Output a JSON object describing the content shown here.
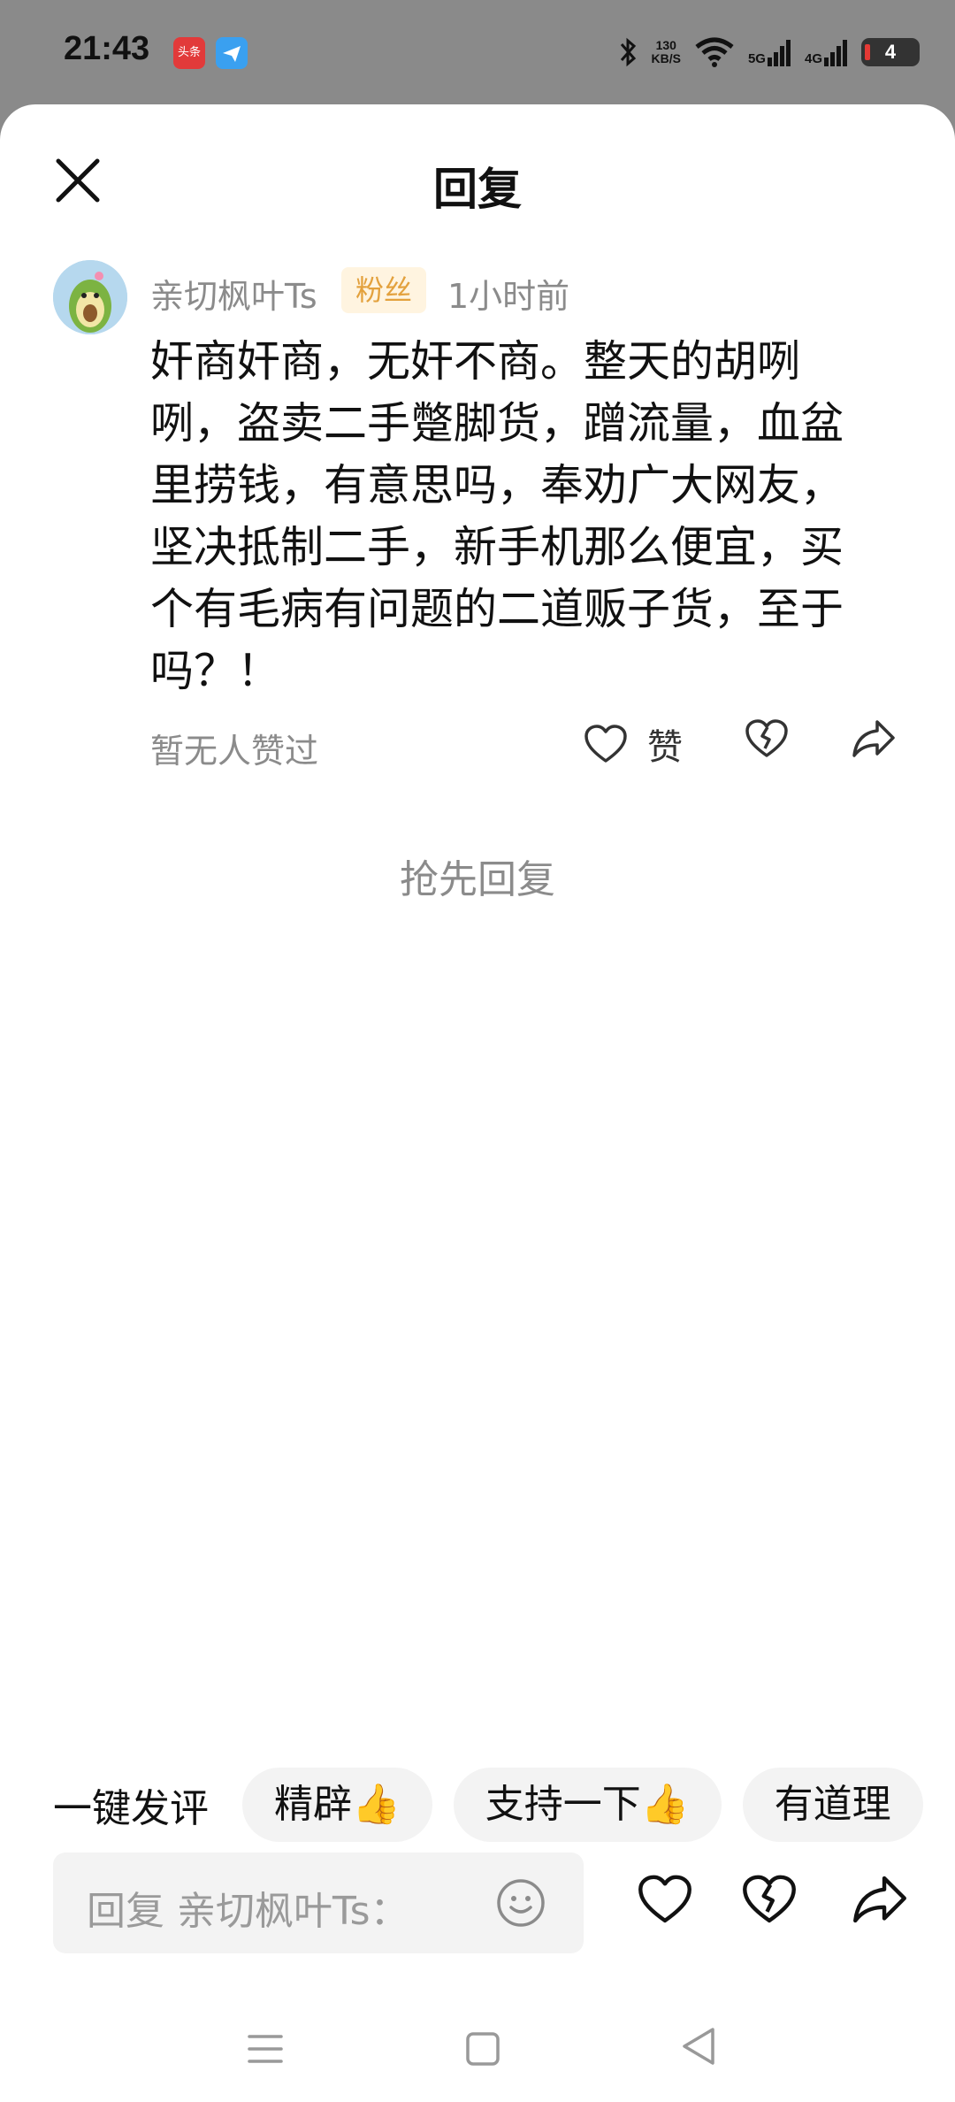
{
  "status_bar": {
    "time": "21:43",
    "app_icon_1_text": "头条",
    "net_speed_value": "130",
    "net_speed_unit": "KB/S",
    "net_5g": "5G",
    "net_4g": "4G",
    "battery": "4"
  },
  "sheet": {
    "title": "回复"
  },
  "comment": {
    "username": "亲切枫叶Ts",
    "badge": "粉丝",
    "time_ago": "1小时前",
    "text": "奸商奸商，无奸不商。整天的胡咧咧，盗卖二手蹩脚货，蹭流量，血盆里捞钱，有意思吗，奉劝广大网友，坚决抵制二手，新手机那么便宜，买个有毛病有问题的二道贩子货，至于吗？！",
    "likes_status": "暂无人赞过",
    "like_label": "赞"
  },
  "empty_state": {
    "first_reply": "抢先回复"
  },
  "quick_reply": {
    "label": "一键发评",
    "chips": [
      "精辟👍",
      "支持一下👍",
      "有道理"
    ]
  },
  "input": {
    "placeholder": "回复 亲切枫叶Ts："
  },
  "icons": {
    "close": "close-icon",
    "heart": "heart-icon",
    "broken_heart": "broken-heart-icon",
    "share": "share-arrow-icon",
    "emoji": "smiley-icon"
  },
  "colors": {
    "badge_text": "#e3a13d",
    "badge_bg": "#fff4e0",
    "muted": "#8b8b8b"
  }
}
